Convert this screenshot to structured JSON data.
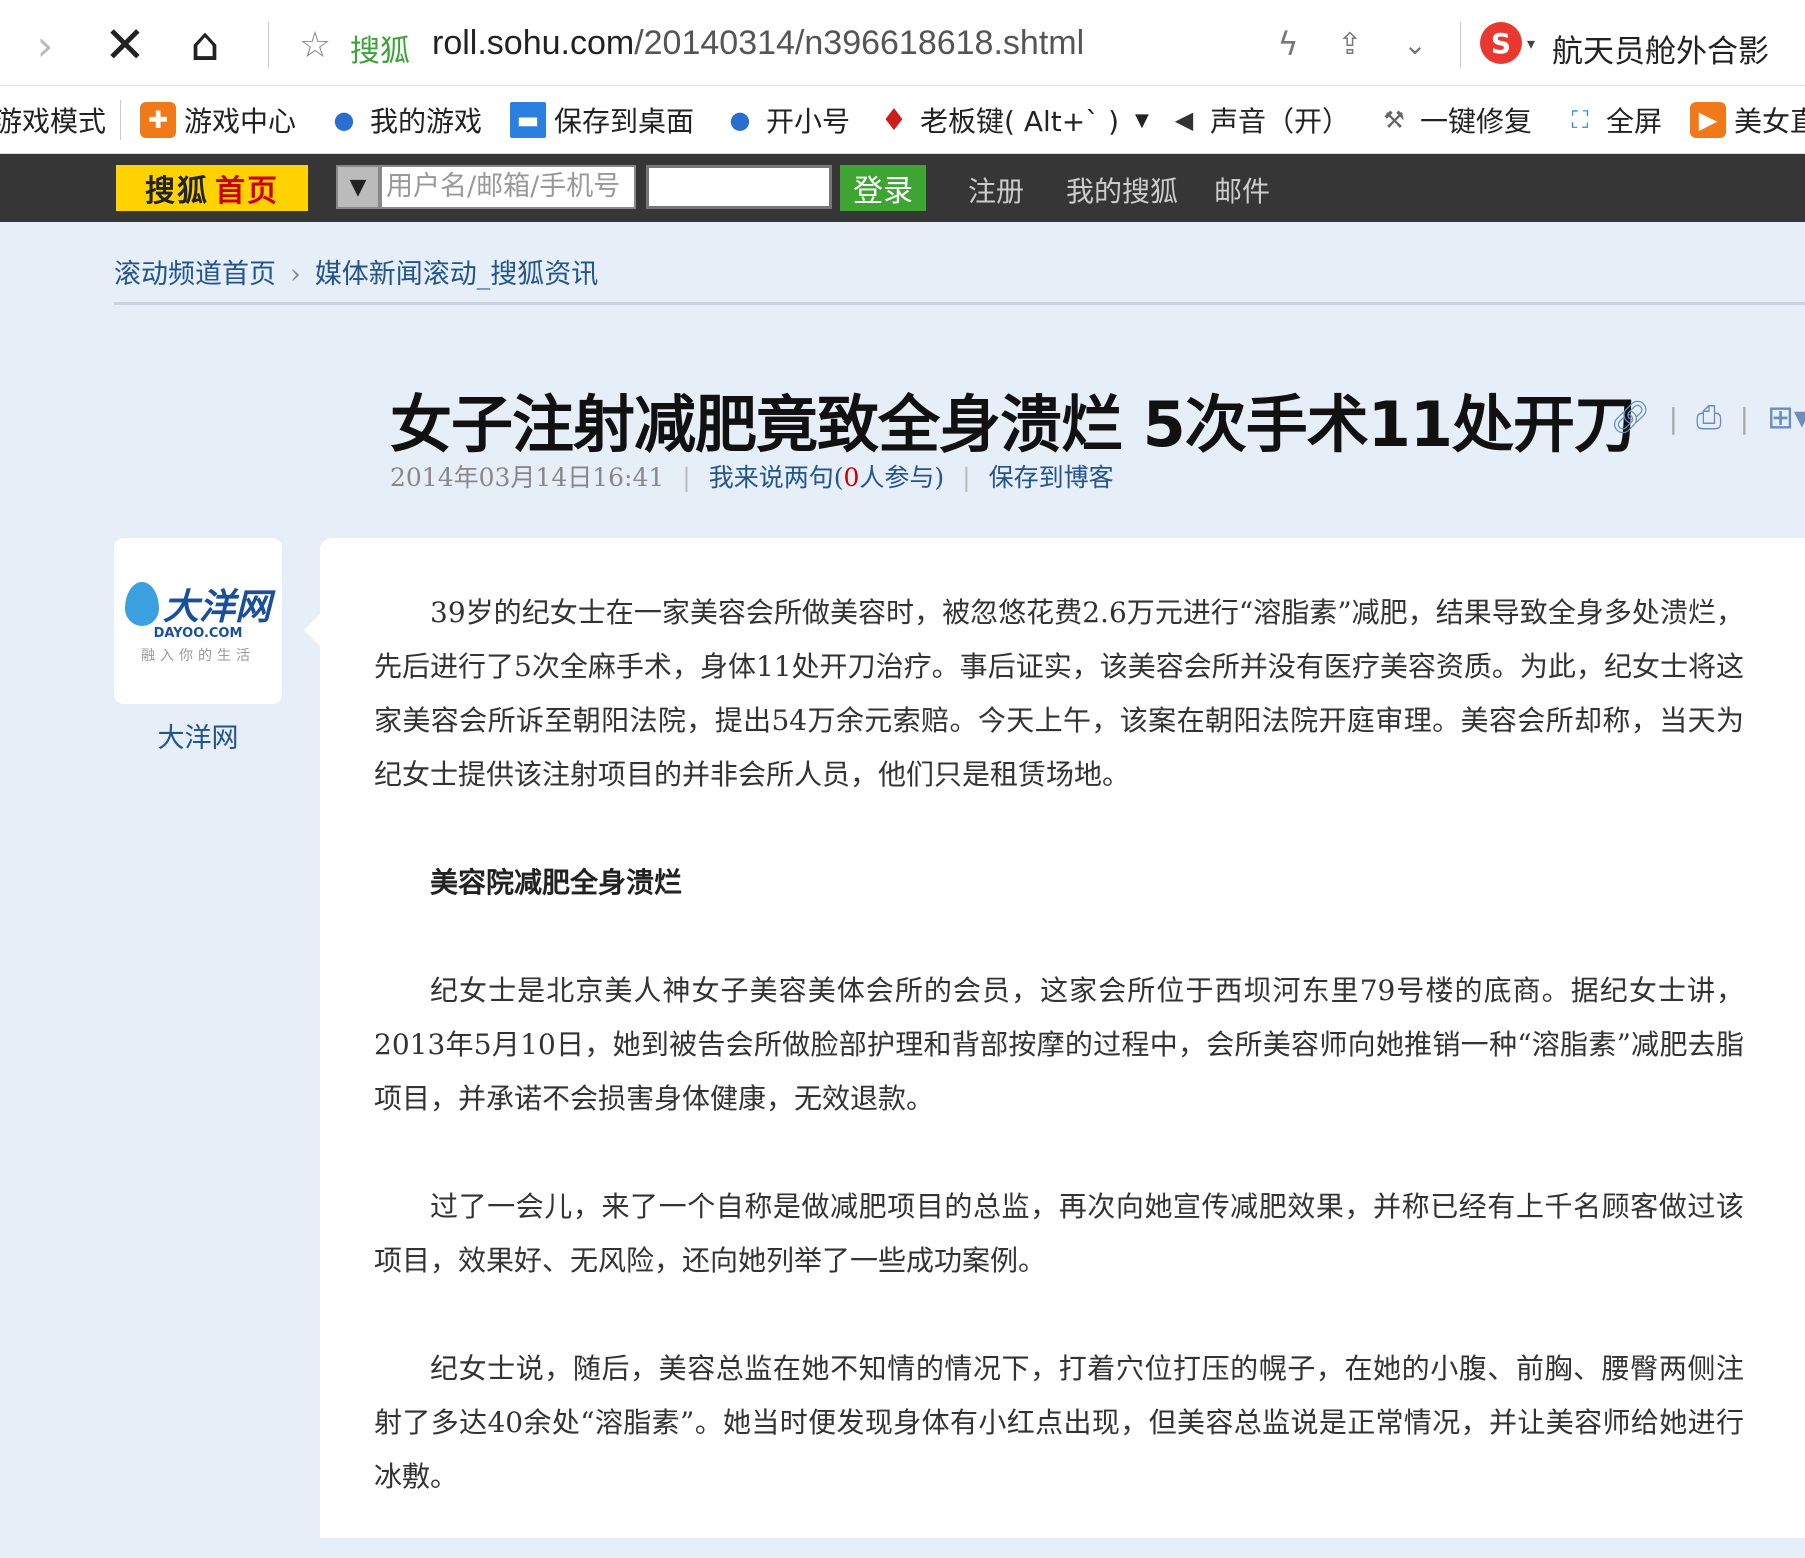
{
  "browser": {
    "site_label": "搜狐",
    "url_host": "roll.sohu.com",
    "url_path": "/20140314/n396618618.shtml",
    "hot_search": "航天员舱外合影"
  },
  "toolbar": [
    {
      "label": "游戏模式",
      "icon": "gamepad-icon"
    },
    {
      "label": "游戏中心",
      "icon": "gamepad-icon"
    },
    {
      "label": "我的游戏",
      "icon": "user-icon"
    },
    {
      "label": "保存到桌面",
      "icon": "monitor-icon"
    },
    {
      "label": "开小号",
      "icon": "users-icon"
    },
    {
      "label": "老板键( Alt+` )",
      "icon": "tie-icon"
    },
    {
      "label": "声音（开）",
      "icon": "speaker-icon"
    },
    {
      "label": "一键修复",
      "icon": "wrench-icon"
    },
    {
      "label": "全屏",
      "icon": "fullscreen-icon"
    },
    {
      "label": "美女直",
      "icon": "video-icon"
    }
  ],
  "sohubar": {
    "logo_a": "搜狐",
    "logo_b": "首页",
    "user_placeholder": "用户名/邮箱/手机号",
    "login": "登录",
    "links": [
      "注册",
      "我的搜狐",
      "邮件"
    ]
  },
  "breadcrumb": {
    "home": "滚动频道首页",
    "current": "媒体新闻滚动_搜狐资讯"
  },
  "article": {
    "title": "女子注射减肥竟致全身溃烂 5次手术11处开刀",
    "date": "2014年03月14日16:41",
    "comment_pre": "我来说两句(",
    "comment_count": "0",
    "comment_post": "人参与)",
    "save_blog": "保存到博客",
    "source": {
      "logo": "大洋网",
      "logo_sub": "DAYOO.COM",
      "slogan": "融入你的生活",
      "name": "大洋网"
    },
    "paragraphs": [
      {
        "text": "39岁的纪女士在一家美容会所做美容时，被忽悠花费2.6万元进行“溶脂素”减肥，结果导致全身多处溃烂，先后进行了5次全麻手术，身体11处开刀治疗。事后证实，该美容会所并没有医疗美容资质。为此，纪女士将这家美容会所诉至朝阳法院，提出54万余元索赔。今天上午，该案在朝阳法院开庭审理。美容会所却称，当天为纪女士提供该注射项目的并非会所人员，他们只是租赁场地。",
        "heading": false
      },
      {
        "text": "美容院减肥全身溃烂",
        "heading": true
      },
      {
        "text": "纪女士是北京美人神女子美容美体会所的会员，这家会所位于西坝河东里79号楼的底商。据纪女士讲，2013年5月10日，她到被告会所做脸部护理和背部按摩的过程中，会所美容师向她推销一种“溶脂素”减肥去脂项目，并承诺不会损害身体健康，无效退款。",
        "heading": false
      },
      {
        "text": "过了一会儿，来了一个自称是做减肥项目的总监，再次向她宣传减肥效果，并称已经有上千名顾客做过该项目，效果好、无风险，还向她列举了一些成功案例。",
        "heading": false
      },
      {
        "text": "纪女士说，随后，美容总监在她不知情的情况下，打着穴位打压的幌子，在她的小腹、前胸、腰臀两侧注射了多达40余处“溶脂素”。她当时便发现身体有小红点出现，但美容总监说是正常情况，并让美容师给她进行冰敷。",
        "heading": false
      }
    ]
  }
}
